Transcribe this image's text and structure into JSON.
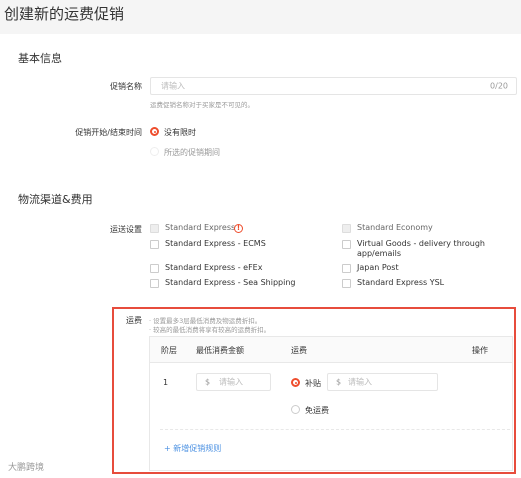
{
  "page": {
    "title": "创建新的运费促销"
  },
  "basic_info": {
    "section_title": "基本信息",
    "promo_name": {
      "label": "促销名称",
      "placeholder": "请输入",
      "counter": "0/20",
      "hint": "运费促销名称对于买家是不可见的。"
    },
    "period": {
      "label": "促销开始/结束时间",
      "options": [
        {
          "label": "没有限时",
          "selected": true
        },
        {
          "label": "所选的促销期间",
          "selected": false
        }
      ]
    }
  },
  "logistics": {
    "section_title": "物流渠道&费用",
    "channel_label": "运送设置",
    "channels": [
      {
        "label": "Standard Express",
        "col": 0,
        "row": 0,
        "warning": true,
        "disabled": true
      },
      {
        "label": "Standard Economy",
        "col": 1,
        "row": 0,
        "disabled": true
      },
      {
        "label": "Standard Express - ECMS",
        "col": 0,
        "row": 1
      },
      {
        "label": "Virtual Goods - delivery through app/emails",
        "col": 1,
        "row": 1
      },
      {
        "label": "Standard Express - eFEx",
        "col": 0,
        "row": 2
      },
      {
        "label": "Japan Post",
        "col": 1,
        "row": 2
      },
      {
        "label": "Standard Express - Sea Shipping",
        "col": 0,
        "row": 3
      },
      {
        "label": "Standard Express YSL",
        "col": 1,
        "row": 3
      }
    ],
    "shipping_fee": {
      "label": "运费",
      "notes": [
        "· 设置最多3层最低消费及物运费折扣。",
        "· 较高的最低消费将享有较高的运费折扣。"
      ],
      "table": {
        "headers": {
          "tier": "阶层",
          "min_spend": "最低消费金额",
          "shipping": "运费",
          "action": "操作"
        },
        "rows": [
          {
            "tier": "1",
            "min_spend_prefix": "$",
            "min_spend_placeholder": "请输入",
            "subsidy_label": "补贴",
            "subsidy_prefix": "$",
            "subsidy_placeholder": "请输入",
            "free_label": "免运费",
            "subsidy_selected": true
          }
        ],
        "add_rule": "+ 新增促销规则"
      }
    }
  },
  "watermark": "大鹏跨境",
  "colors": {
    "accent": "#ee4d2d",
    "highlight_box": "#e74c3c",
    "link": "#4a90e2"
  }
}
